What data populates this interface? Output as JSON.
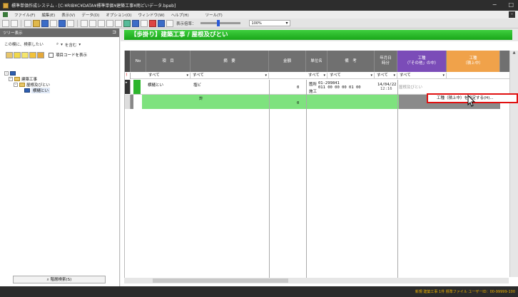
{
  "window": {
    "title": "標準単価作成システム - [C:¥RIB¥C¥DATA¥標準単価¥建築工事¥雨どいデータ.bpeb]",
    "minimize": "−",
    "maximize": "□"
  },
  "menu": [
    "ファイル(F)",
    "編集(E)",
    "表示(V)",
    "データ(D)",
    "オプション(O)",
    "ウィンドウ(W)",
    "ヘルプ(H)",
    "ツール(T)"
  ],
  "toolbar": {
    "display_scale_label": "表示倍率：",
    "zoom_value": "100%",
    "zoom_fraction": 0.45
  },
  "tree_panel": {
    "header": "ツリー表示",
    "search_placeholder": "この欄に、検索したい",
    "search_option": "を含む",
    "code_checkbox_label": "項目コードを表示",
    "swatch_colors": [
      "#e8c66a",
      "#f0d84a",
      "#f5e56a",
      "#f2c23a",
      "#e4a83a"
    ],
    "nodes": [
      {
        "label": "",
        "level": 0,
        "kind": "root"
      },
      {
        "label": "建築工事",
        "level": 1,
        "kind": "folder"
      },
      {
        "label": "屋根及びとい",
        "level": 2,
        "kind": "folder"
      },
      {
        "label": "横樋とい",
        "level": 3,
        "kind": "leaf"
      }
    ],
    "search_button": "階層検索(S)"
  },
  "sheet": {
    "title": "【歩掛り】建築工事 / 屋根及びとい",
    "columns": [
      {
        "label": "No"
      },
      {
        "label": "項　目"
      },
      {
        "label": "摘　要"
      },
      {
        "label": "金額"
      },
      {
        "label": "単位名"
      },
      {
        "label": "備　考"
      },
      {
        "label": "年月日\n時分"
      },
      {
        "label": "工種\n（「その他」の中）"
      },
      {
        "label": "工種\n（積上中）"
      }
    ],
    "filters": [
      "すべて",
      "すべて",
      "すべて",
      "すべて",
      "すべて",
      "すべて"
    ],
    "row1": {
      "item": "横樋とい",
      "spec": "塩ビ",
      "amount": "0",
      "unit1": "箇所",
      "unit2": "施工",
      "note_line1": "01-299841",
      "note_line2": "011 00  00  00  01  00",
      "date_line1": "14/04/22",
      "date_line2": "12:16",
      "type_other": "屋根及びとい"
    },
    "total_row": {
      "label": "計",
      "amount": "0"
    }
  },
  "context_menu": {
    "item": "工種（積上中）を設定する(H)..."
  },
  "status": {
    "text": "新規  建築工事  1件  標準ファイル  ユーザーID：00-99999-100"
  }
}
